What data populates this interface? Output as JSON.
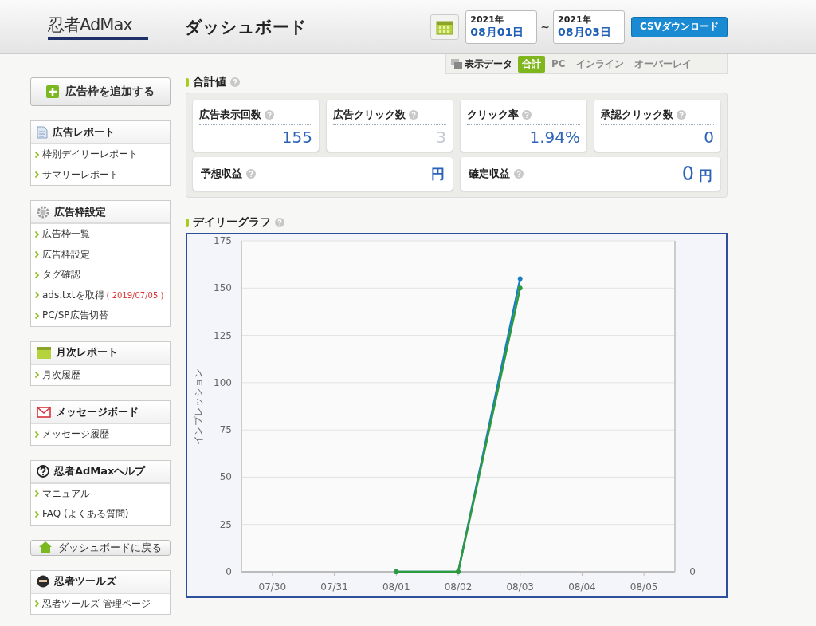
{
  "header": {
    "logo": "忍者AdMax",
    "title": "ダッシュボード",
    "date_from": {
      "year": "2021年",
      "date": "08月01日"
    },
    "separator": "~",
    "date_to": {
      "year": "2021年",
      "date": "08月03日"
    },
    "csv_button": "CSVダウンロード"
  },
  "data_tabs": {
    "label": "表示データ",
    "tabs": [
      {
        "label": "合計",
        "selected": true
      },
      {
        "label": "PC",
        "selected": false
      },
      {
        "label": "インライン",
        "selected": false
      },
      {
        "label": "オーバーレイ",
        "selected": false
      }
    ]
  },
  "sidebar": [
    {
      "kind": "button",
      "label": "広告枠を追加する"
    },
    {
      "kind": "panel",
      "title": "広告レポート",
      "items": [
        {
          "label": "枠別デイリーレポート"
        },
        {
          "label": "サマリーレポート"
        }
      ]
    },
    {
      "kind": "panel",
      "title": "広告枠設定",
      "items": [
        {
          "label": "広告枠一覧"
        },
        {
          "label": "広告枠設定"
        },
        {
          "label": "タグ確認"
        },
        {
          "label": "ads.txtを取得",
          "note": "( 2019/07/05 )"
        },
        {
          "label": "PC/SP広告切替"
        }
      ]
    },
    {
      "kind": "panel",
      "title": "月次レポート",
      "items": [
        {
          "label": "月次履歴"
        }
      ]
    },
    {
      "kind": "panel",
      "title": "メッセージボード",
      "items": [
        {
          "label": "メッセージ履歴"
        }
      ]
    },
    {
      "kind": "panel",
      "title": "忍者AdMaxヘルプ",
      "items": [
        {
          "label": "マニュアル"
        },
        {
          "label": "FAQ (よくある質問)"
        }
      ]
    },
    {
      "kind": "button",
      "label": "ダッシュボードに戻る"
    },
    {
      "kind": "panel",
      "title": "忍者ツールズ",
      "items": [
        {
          "label": "忍者ツールズ 管理ページ"
        }
      ]
    }
  ],
  "summary": {
    "title": "合計値",
    "stats": [
      {
        "label": "広告表示回数",
        "value": "155"
      },
      {
        "label": "広告クリック数",
        "value": "3"
      },
      {
        "label": "クリック率",
        "value": "1.94%"
      },
      {
        "label": "承認クリック数",
        "value": "0"
      }
    ],
    "revenue": [
      {
        "label": "予想収益",
        "unit": "円"
      },
      {
        "label": "確定収益",
        "value": "0",
        "unit": "円"
      }
    ]
  },
  "daily_graph": {
    "title": "デイリーグラフ",
    "right_axis_label": "0",
    "chart_data": {
      "type": "line",
      "ylabel": "インプレッション",
      "categories": [
        "07/30",
        "07/31",
        "08/01",
        "08/02",
        "08/03",
        "08/04",
        "08/05"
      ],
      "series": [
        {
          "color": "#1a7fc0",
          "marker": true,
          "values": [
            null,
            null,
            0,
            0,
            155,
            null,
            null
          ]
        },
        {
          "color": "#2e9a3e",
          "marker": true,
          "values": [
            null,
            null,
            0,
            0,
            150,
            null,
            null
          ]
        }
      ],
      "grid": true,
      "ylim": [
        0,
        175
      ],
      "yticks": [
        0,
        25,
        50,
        75,
        100,
        125,
        150,
        175
      ]
    }
  }
}
